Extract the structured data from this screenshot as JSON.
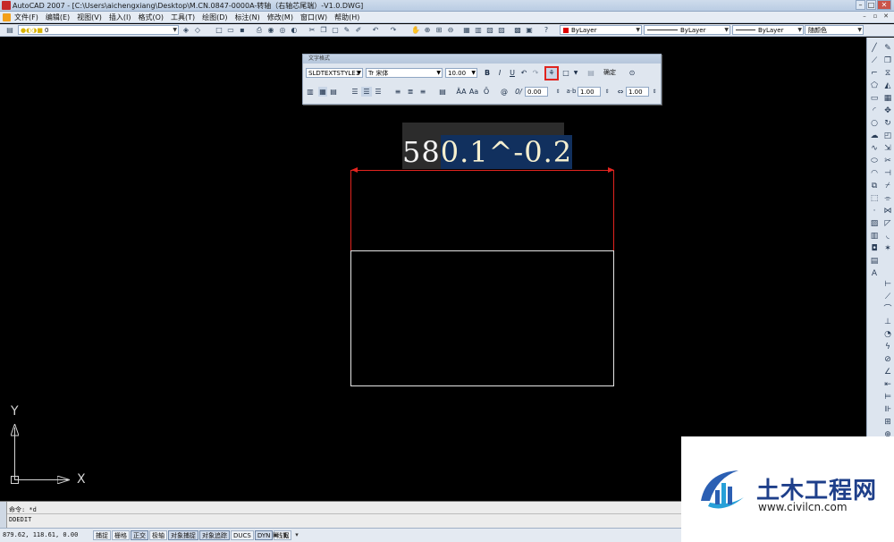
{
  "window": {
    "title": "AutoCAD 2007 - [C:\\Users\\aichengxiang\\Desktop\\M.CN.0847-0000A-转轴（右轴芯尾端）-V1.0.DWG]",
    "minimize": "–",
    "maximize": "□",
    "close": "✕"
  },
  "menubar": {
    "items": [
      "文件(F)",
      "编辑(E)",
      "视图(V)",
      "插入(I)",
      "格式(O)",
      "工具(T)",
      "绘图(D)",
      "标注(N)",
      "修改(M)",
      "窗口(W)",
      "帮助(H)"
    ],
    "doc_min": "–",
    "doc_restore": "▫",
    "doc_close": "✕"
  },
  "toolbar": {
    "layer_value": "0",
    "color_value": "ByLayer",
    "linetype_value": "ByLayer",
    "lineweight_value": "ByLayer",
    "plotstyle_value": "随颜色",
    "accent_color": "#dd0000"
  },
  "text_formatting": {
    "caption": "文字格式",
    "style": "SLDTEXTSTYLE1",
    "font_icon": "Tr",
    "font": "宋体",
    "height": "10.00",
    "bold": "B",
    "italic": "I",
    "underline": "U",
    "undo": "↶",
    "redo": "↷",
    "stack_icon": "stack-icon",
    "ok_label": "确定",
    "oblique": "0.00",
    "tracking": "1.00",
    "width_factor": "1.00",
    "at": "@",
    "oblique_label": "0/"
  },
  "mtext": {
    "plain": "58",
    "selected": "0.1^-0.2"
  },
  "ucs": {
    "x_label": "X",
    "y_label": "Y"
  },
  "command": {
    "line1": "命令: *d",
    "line2": "DDEDIT"
  },
  "status": {
    "coords": "879.62, 118.61, 0.00",
    "toggles": [
      {
        "label": "捕捉",
        "on": false
      },
      {
        "label": "栅格",
        "on": false
      },
      {
        "label": "正交",
        "on": true
      },
      {
        "label": "极轴",
        "on": false
      },
      {
        "label": "对象捕捉",
        "on": true
      },
      {
        "label": "对象追踪",
        "on": true
      },
      {
        "label": "DUCS",
        "on": false
      },
      {
        "label": "DYN",
        "on": true
      },
      {
        "label": "线宽",
        "on": false
      }
    ]
  },
  "watermark": {
    "title": "土木工程网",
    "url": "www.civilcn.com"
  }
}
